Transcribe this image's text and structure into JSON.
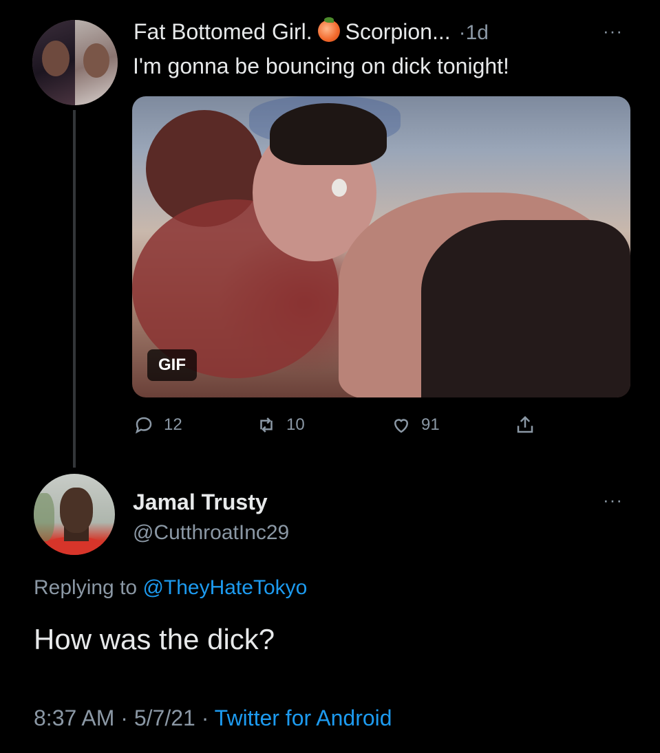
{
  "tweet1": {
    "display_name": "Fat Bottomed Girl.",
    "name_suffix": "Scorpion...",
    "emoji": "peach-icon",
    "age": "1d",
    "separator": "·",
    "more": "···",
    "text": "I'm gonna be bouncing on dick tonight!",
    "media_badge": "GIF",
    "actions": {
      "replies": "12",
      "retweets": "10",
      "likes": "91"
    }
  },
  "tweet2": {
    "display_name": "Jamal Trusty",
    "handle": "@CutthroatInc29",
    "more": "···",
    "replying_prefix": "Replying to",
    "replying_to": "@TheyHateTokyo",
    "text": "How was the dick?",
    "time": "8:37 AM",
    "date": "5/7/21",
    "source": "Twitter for Android",
    "separator": "·"
  },
  "colors": {
    "background": "#000000",
    "text": "#e7e9ea",
    "secondary": "#8b98a5",
    "link": "#1d9bf0"
  }
}
